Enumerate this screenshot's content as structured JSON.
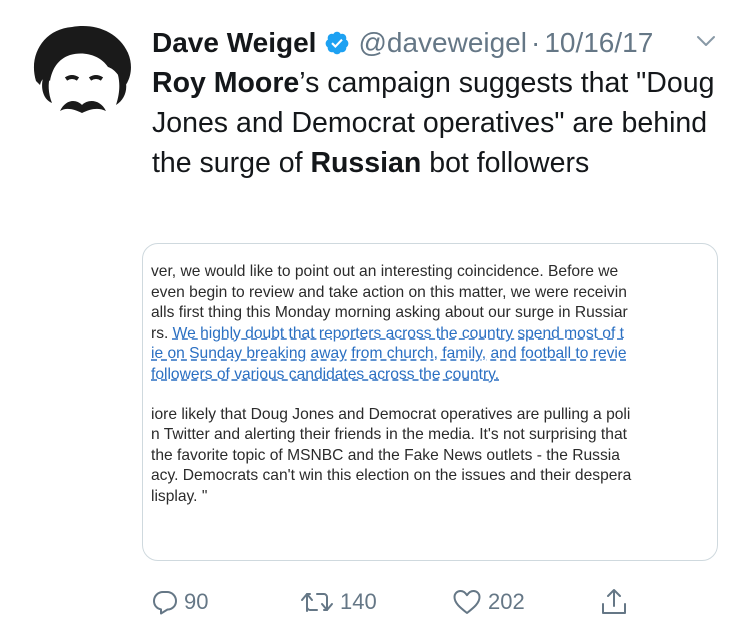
{
  "author": {
    "display_name": "Dave Weigel",
    "handle": "@daveweigel",
    "separator": "·",
    "date": "10/16/17"
  },
  "tweet": {
    "part1_bold": "Roy Moore",
    "part2": "’s campaign suggests that \"Doug Jones and Democrat operatives\" are behind the surge of ",
    "part3_bold": "Russian",
    "part4": " bot followers"
  },
  "attachment": {
    "lines": [
      "ver, we would like to point out an interesting coincidence.  Before we",
      "even begin to review and take action on this matter, we were receivin",
      "alls first thing this Monday morning asking about our surge in Russiar",
      "rs.  "
    ],
    "link_inline": "We highly doubt that reporters across the country spend most of t",
    "link_lines": [
      "ie on Sunday breaking away from church, family, and football to revie",
      "followers of various candidates across the country."
    ],
    "lines_after": [
      "iore likely that Doug Jones and Democrat operatives are pulling a poli",
      "n Twitter and alerting their friends in the media. It's not surprising that",
      " the favorite topic of MSNBC and the Fake News outlets - the Russia",
      "acy. Democrats can't win this election on the issues and their despera",
      "lisplay. \""
    ]
  },
  "actions": {
    "replies": "90",
    "retweets": "140",
    "likes": "202"
  },
  "colors": {
    "text": "#14171a",
    "secondary": "#657786",
    "verified": "#1da1f2",
    "link": "#2a6fc2"
  }
}
